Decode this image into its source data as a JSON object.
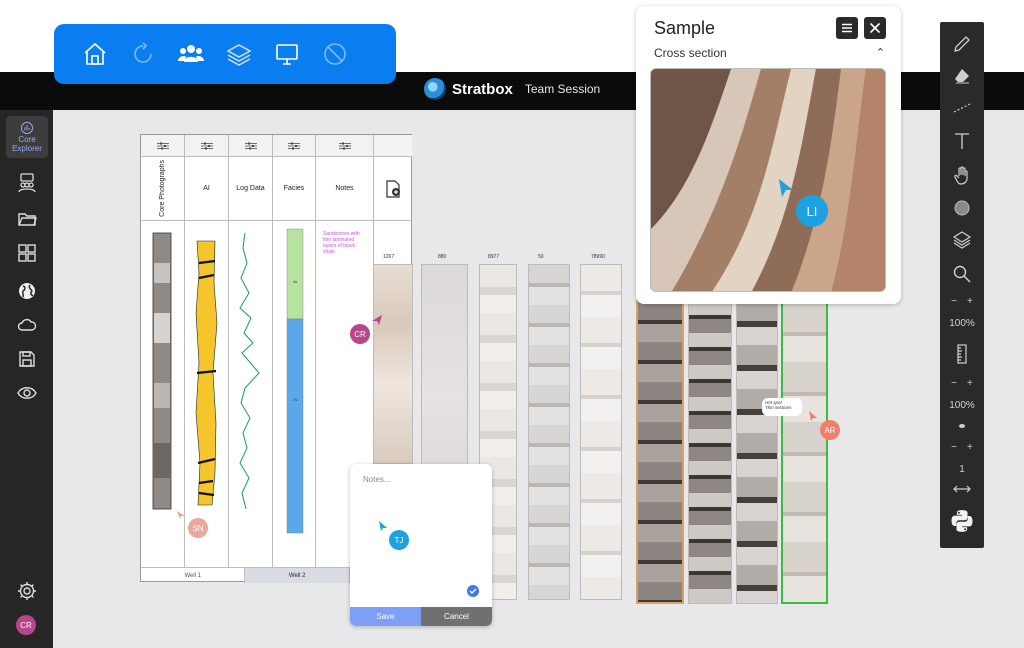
{
  "app": {
    "brand": "Stratbox",
    "session": "Team Session"
  },
  "toolbar": {
    "icons": [
      "home-icon",
      "refresh-icon",
      "users-icon",
      "layers-icon",
      "monitor-icon",
      "block-icon"
    ]
  },
  "sidebar": {
    "active_label": "Core Explorer",
    "avatar": "CR"
  },
  "columns": {
    "core_photographs": "Core Photographs",
    "ai": "AI",
    "log_data": "Log Data",
    "facies": "Facies",
    "notes": "Notes"
  },
  "notes_text": "Sandstones with thin laminated layers of black shale",
  "wells": [
    "Well 1",
    "Well 2",
    ""
  ],
  "core_labels": [
    "1267",
    "880",
    "8977",
    "50",
    "78990"
  ],
  "facies_labels": [
    "4s",
    "7s"
  ],
  "sample": {
    "title": "Sample",
    "subtitle": "Cross section"
  },
  "notes_popup": {
    "placeholder": "Notes...",
    "save": "Save",
    "cancel": "Cancel"
  },
  "annotation": {
    "line1": "Hot spot",
    "line2": "Thin sections"
  },
  "cursors": [
    {
      "initials": "LI",
      "color": "#1da1e0"
    },
    {
      "initials": "CR",
      "color": "#b5478a"
    },
    {
      "initials": "SN",
      "color": "#e8a89b"
    },
    {
      "initials": "TJ",
      "color": "#1da1e0"
    },
    {
      "initials": "AR",
      "color": "#f0806a"
    }
  ],
  "rightbar": {
    "zoom1": "100%",
    "zoom2": "100%",
    "count": "1",
    "minus": "−",
    "plus": "+"
  }
}
